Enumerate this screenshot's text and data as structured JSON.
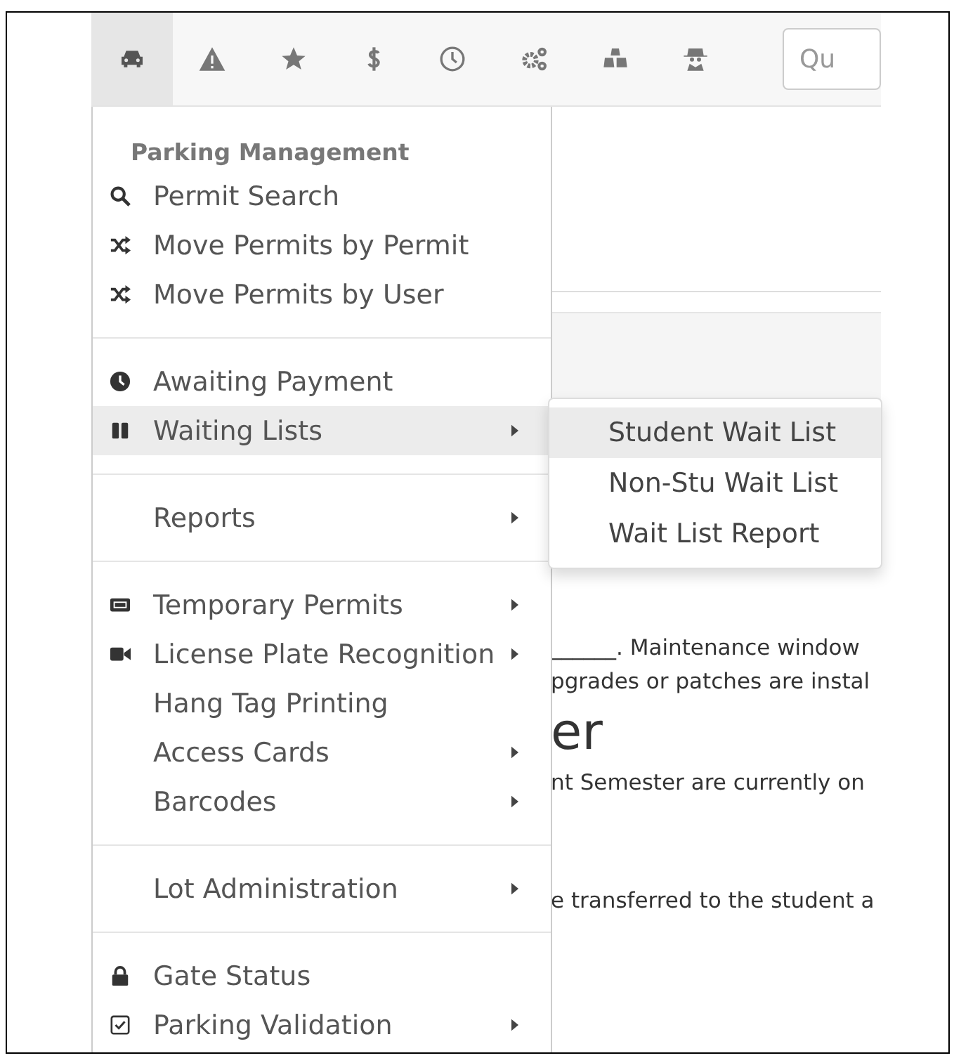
{
  "toolbar": {
    "icons": [
      {
        "kind": "car",
        "selected": true
      },
      {
        "kind": "warning",
        "selected": false
      },
      {
        "kind": "star",
        "selected": false
      },
      {
        "kind": "dollar",
        "selected": false
      },
      {
        "kind": "clock",
        "selected": false
      },
      {
        "kind": "gears",
        "selected": false
      },
      {
        "kind": "cubes",
        "selected": false
      },
      {
        "kind": "spy",
        "selected": false
      }
    ],
    "search": {
      "placeholder": "Qu"
    }
  },
  "page": {
    "lines": [
      {
        "kind": "text",
        "text": "______. Maintenance window"
      },
      {
        "kind": "text",
        "text": "pgrades or patches are instal"
      },
      {
        "kind": "heading",
        "text": "er"
      },
      {
        "kind": "text",
        "text": "nt Semester are currently on"
      },
      {
        "kind": "gap"
      },
      {
        "kind": "text",
        "text": "e transferred to the student a"
      }
    ]
  },
  "menu": {
    "title": "Parking Management",
    "sections": [
      {
        "items": [
          {
            "label": "Permit Search",
            "kind": "search",
            "submenu": false,
            "selected": false
          },
          {
            "label": "Move Permits by Permit",
            "kind": "shuffle",
            "submenu": false,
            "selected": false
          },
          {
            "label": "Move Permits by User",
            "kind": "shuffle",
            "submenu": false,
            "selected": false
          }
        ]
      },
      {
        "items": [
          {
            "label": "Awaiting Payment",
            "kind": "clock",
            "submenu": false,
            "selected": false
          },
          {
            "label": "Waiting Lists",
            "kind": "pause",
            "submenu": true,
            "selected": true
          }
        ]
      },
      {
        "items": [
          {
            "label": "Reports",
            "submenu": true,
            "selected": false
          }
        ]
      },
      {
        "items": [
          {
            "label": "Temporary Permits",
            "kind": "ticket",
            "submenu": true,
            "selected": false
          },
          {
            "label": "License Plate Recognition",
            "kind": "video",
            "submenu": true,
            "selected": false
          },
          {
            "label": "Hang Tag Printing",
            "submenu": false,
            "selected": false
          },
          {
            "label": "Access Cards",
            "submenu": true,
            "selected": false
          },
          {
            "label": "Barcodes",
            "submenu": true,
            "selected": false
          }
        ]
      },
      {
        "items": [
          {
            "label": "Lot Administration",
            "submenu": true,
            "selected": false
          }
        ]
      },
      {
        "items": [
          {
            "label": "Gate Status",
            "kind": "lock",
            "submenu": false,
            "selected": false
          },
          {
            "label": "Parking Validation",
            "kind": "checkbox",
            "submenu": true,
            "selected": false
          }
        ]
      }
    ]
  },
  "submenu": {
    "items": [
      {
        "label": "Student Wait List",
        "selected": true
      },
      {
        "label": "Non-Stu Wait List",
        "selected": false
      },
      {
        "label": "Wait List Report",
        "selected": false
      }
    ]
  }
}
